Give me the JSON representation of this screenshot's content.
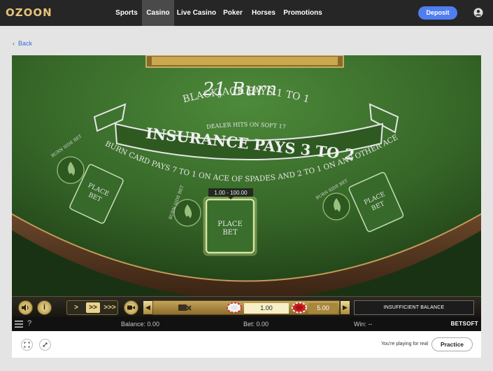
{
  "nav": {
    "logo": "OZOON",
    "items": [
      "Sports",
      "Casino",
      "Live Casino",
      "Poker",
      "Horses",
      "Promotions"
    ],
    "active": "Casino",
    "deposit_label": "Deposit"
  },
  "back_label": "Back",
  "game": {
    "title": "21 Burn",
    "arc1": "BLACKJACK PAYS 1 TO 1",
    "arc2": "DEALER HITS ON SOFT 17",
    "banner": "INSURANCE PAYS 3 TO 2",
    "arc3": "BURN CARD PAYS 7 TO 1 ON ACE OF SPADES AND 2 TO 1 ON ANY OTHER ACE",
    "side_bet_label": "BURN SIDE BET",
    "place_bet_line1": "PLACE",
    "place_bet_line2": "BET",
    "bet_range": "1.00 - 100.00",
    "chip_value_1": "1.00",
    "chip_value_2": "5.00",
    "status": "INSUFFICIENT BALANCE",
    "speed_labels": [
      ">",
      ">>",
      ">>>"
    ],
    "help_label": "?",
    "balance": "Balance: 0.00",
    "bet": "Bet: 0.00",
    "win": "Win: --",
    "provider": "BETSOFT"
  },
  "footer": {
    "real_text": "You're playing for real",
    "practice_label": "Practice"
  },
  "colors": {
    "nav_bg": "#262626",
    "deposit": "#4f7ef0",
    "felt": "#3a6a2c",
    "gold": "#d4b66a"
  },
  "icons": [
    "user-icon",
    "volume-icon",
    "info-icon",
    "video-icon",
    "menu-icon",
    "fullscreen-icon",
    "minimize-icon",
    "fire-icon"
  ]
}
